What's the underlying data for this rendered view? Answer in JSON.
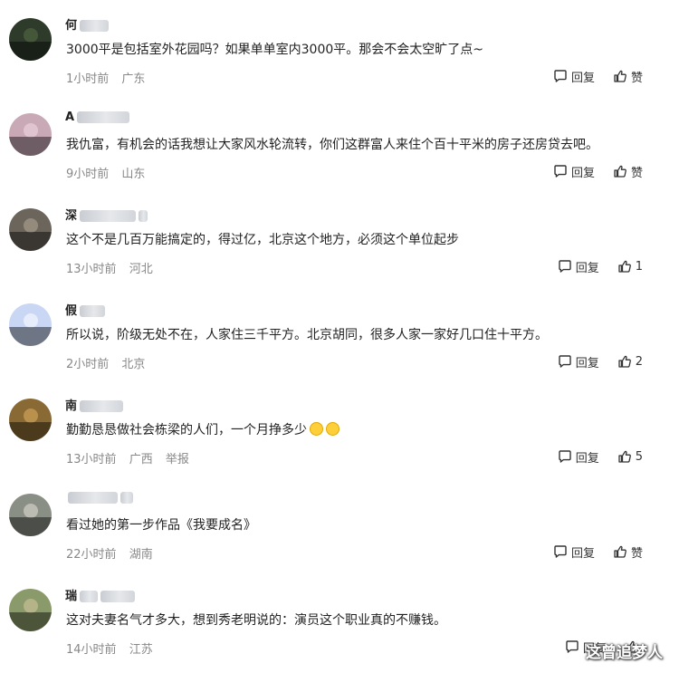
{
  "labels": {
    "reply": "回复",
    "like": "赞"
  },
  "comments": [
    {
      "username": "何",
      "text": "3000平是包括室外花园吗？如果单单室内3000平。那会不会太空旷了点~",
      "time": "1小时前",
      "location": "广东",
      "extra": "",
      "likes": "赞",
      "avatar_color": "#2e3b2a",
      "avatar_accent": "#5a7045"
    },
    {
      "username": "A",
      "text": "我仇富，有机会的话我想让大家风水轮流转，你们这群富人来住个百十平米的房子还房贷去吧。",
      "time": "9小时前",
      "location": "山东",
      "extra": "",
      "likes": "赞",
      "avatar_color": "#c9a9b6",
      "avatar_accent": "#f2dce5"
    },
    {
      "username": "深",
      "text": "这个不是几百万能搞定的，得过亿，北京这个地方，必须这个单位起步",
      "time": "13小时前",
      "location": "河北",
      "extra": "",
      "likes": "1",
      "avatar_color": "#6b655c",
      "avatar_accent": "#b8ab98"
    },
    {
      "username": "假",
      "text": "所以说，阶级无处不在，人家住三千平方。北京胡同，很多人家一家好几口住十平方。",
      "time": "2小时前",
      "location": "北京",
      "extra": "",
      "likes": "2",
      "avatar_color": "#c9d7f5",
      "avatar_accent": "#ffffff"
    },
    {
      "username": "南",
      "text": "勤勤恳恳做社会栋梁的人们，一个月挣多少",
      "time": "13小时前",
      "location": "广西",
      "extra": "举报",
      "likes": "5",
      "avatar_color": "#8a6a34",
      "avatar_accent": "#e0b060"
    },
    {
      "username": "",
      "text": "看过她的第一步作品《我要成名》",
      "time": "22小时前",
      "location": "湖南",
      "extra": "",
      "likes": "赞",
      "avatar_color": "#8a8f86",
      "avatar_accent": "#e8e2d8"
    },
    {
      "username": "瑞",
      "text": "这对夫妻名气才多大，想到秀老明说的：演员这个职业真的不赚钱。",
      "time": "14小时前",
      "location": "江苏",
      "extra": "",
      "likes": "",
      "avatar_color": "#8a9a6a",
      "avatar_accent": "#d8c8a0"
    }
  ],
  "watermark": "这曾追梦人",
  "icons": {
    "reply": "reply-icon",
    "like": "thumbs-up-icon",
    "emoji": "laughing-emoji-icon"
  }
}
